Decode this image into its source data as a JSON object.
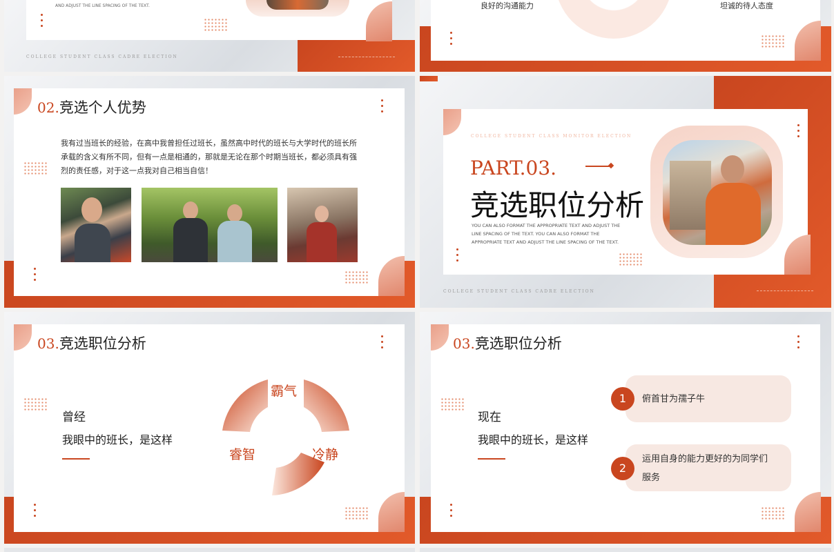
{
  "top_left": {
    "text": "AND ADJUST THE LINE SPACING OF THE TEXT.",
    "footer": "COLLEGE STUDENT CLASS CADRE ELECTION"
  },
  "top_right": {
    "left_text": "良好的沟通能力",
    "right_text": "坦诚的待人态度"
  },
  "slide_advantage": {
    "num": "02.",
    "title": "竞选个人优势",
    "body": "我有过当班长的经验，在高中我曾担任过班长，虽然高中时代的班长与大学时代的班长所承载的含义有所不同，但有一点是相通的，那就是无论在那个时期当班长，都必须具有强烈的责任感，对于这一点我对自己相当自信！"
  },
  "slide_part": {
    "caption": "COLLEGE STUDENT CLASS MONITOR ELECTION",
    "part": "PART.03.",
    "title": "竞选职位分析",
    "desc": "YOU CAN ALSO FORMAT THE APPROPRIATE TEXT AND ADJUST THE LINE SPACING OF THE TEXT. YOU CAN ALSO FORMAT THE APPROPRIATE TEXT AND ADJUST THE LINE SPACING OF THE TEXT.",
    "footer": "COLLEGE STUDENT CLASS CADRE ELECTION"
  },
  "slide_past": {
    "num": "03.",
    "title": "竞选职位分析",
    "line1": "曾经",
    "line2": "我眼中的班长，是这样",
    "ring_labels": [
      "霸气",
      "睿智",
      "冷静"
    ]
  },
  "slide_now": {
    "num": "03.",
    "title": "竞选职位分析",
    "line1": "现在",
    "line2": "我眼中的班长，是这样",
    "items": [
      {
        "n": "1",
        "text": "俯首甘为孺子牛"
      },
      {
        "n": "2",
        "text": "运用自身的能力更好的为同学们服务"
      }
    ]
  },
  "colors": {
    "accent": "#c9461f",
    "soft": "#f7e8e2"
  }
}
